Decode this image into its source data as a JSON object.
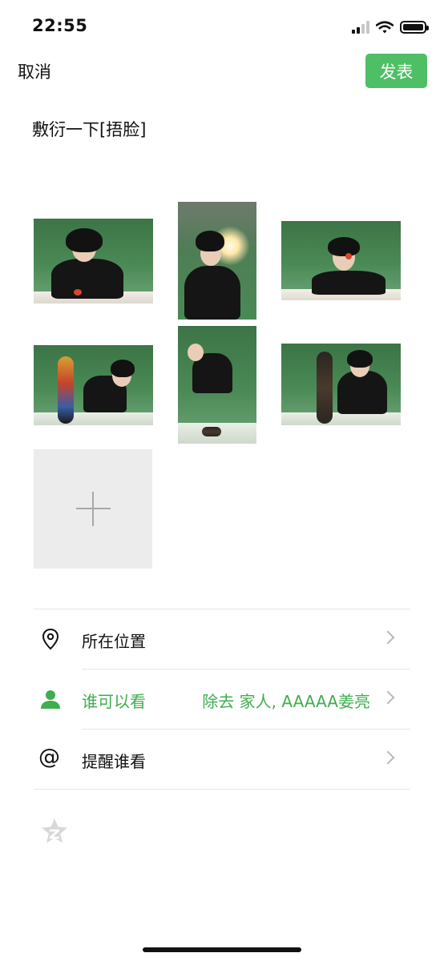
{
  "status_bar": {
    "time": "22:55",
    "icons": [
      "signal-icon",
      "wifi-icon",
      "battery-icon"
    ]
  },
  "nav": {
    "cancel_label": "取消",
    "publish_label": "发表"
  },
  "post": {
    "text": "敷衍一下[捂脸]"
  },
  "photos": [
    "photo-1",
    "photo-2",
    "photo-3",
    "photo-4",
    "photo-5",
    "photo-6"
  ],
  "add_photo": {
    "icon": "plus-icon"
  },
  "options": [
    {
      "icon": "location-pin-icon",
      "label": "所在位置",
      "value": ""
    },
    {
      "icon": "person-icon",
      "label": "谁可以看",
      "value": "除去 家人, AAAAA姜亮"
    },
    {
      "icon": "at-icon",
      "label": "提醒谁看",
      "value": ""
    }
  ],
  "extra": {
    "icon": "qzone-star-icon"
  },
  "colors": {
    "accent_green": "#4fbf66",
    "selected_green": "#3fae4e",
    "tile_gray": "#ececec"
  }
}
